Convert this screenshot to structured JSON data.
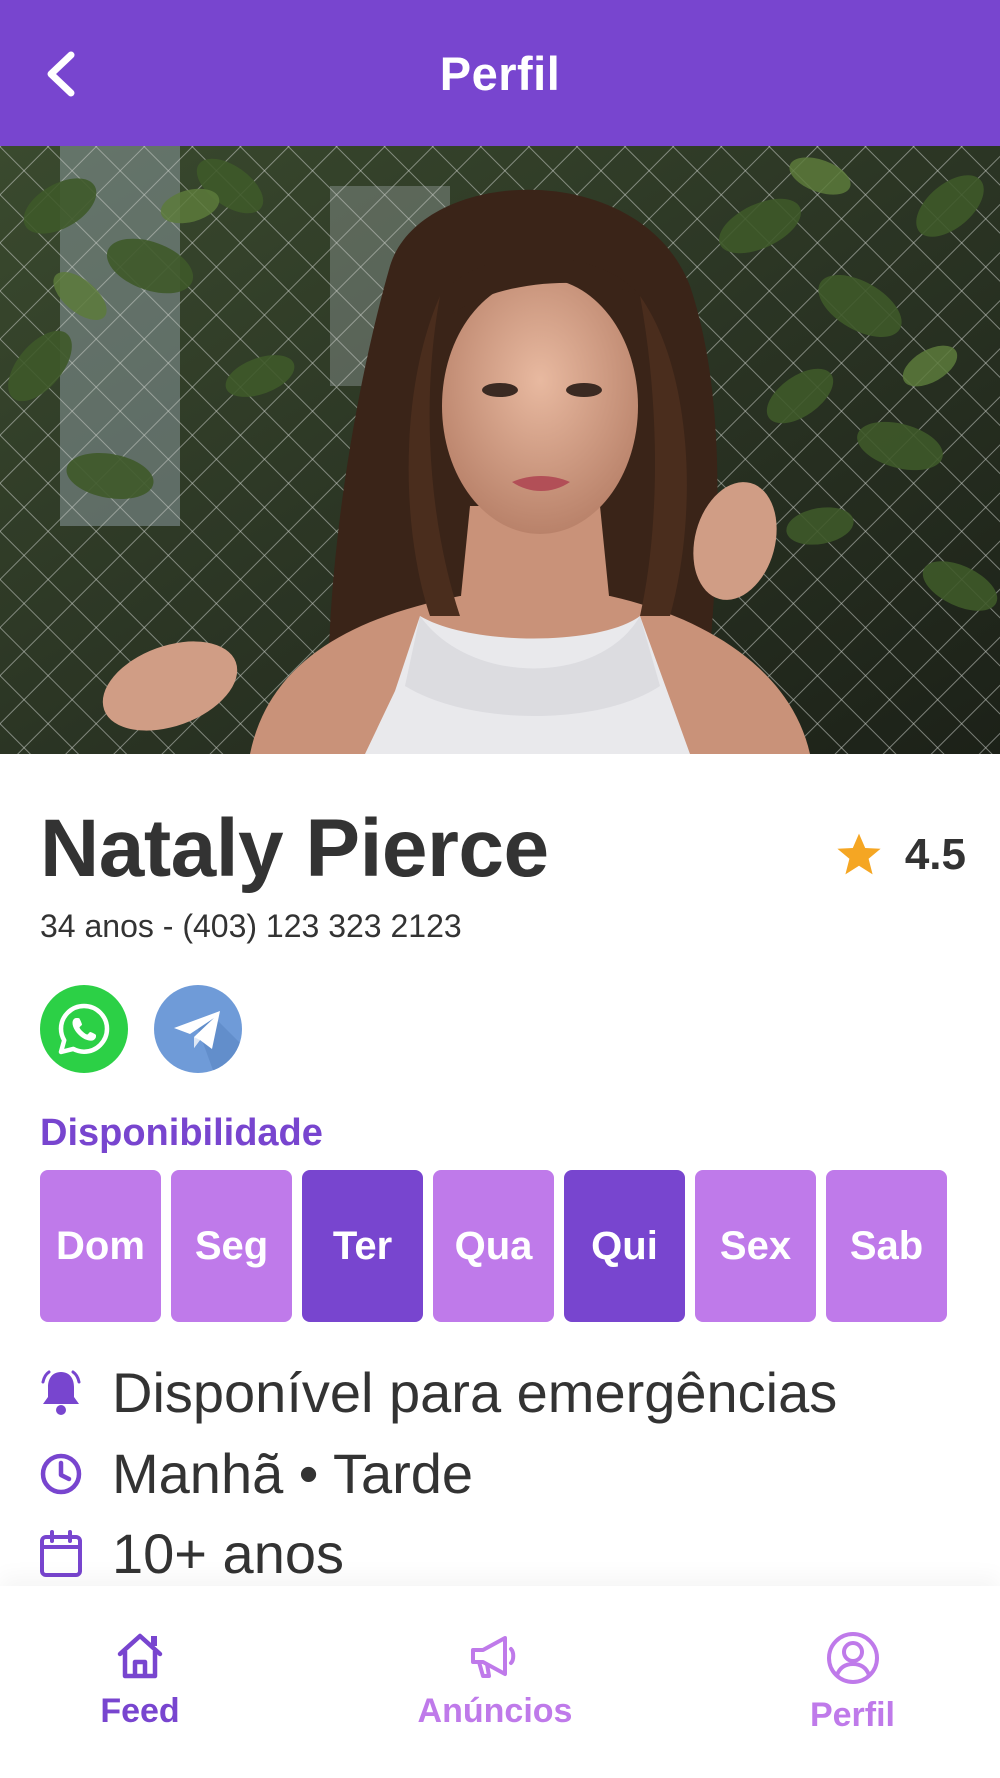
{
  "header": {
    "title": "Perfil",
    "back_icon": "chevron-left-icon"
  },
  "photo": {
    "description_icon": "profile-photo"
  },
  "profile": {
    "name": "Nataly Pierce",
    "rating": "4.5",
    "subinfo": "34 anos - (403) 123 323 2123"
  },
  "social": [
    {
      "name": "whatsapp-icon",
      "color": "#2CD046"
    },
    {
      "name": "telegram-icon",
      "color": "#6F9BD8"
    }
  ],
  "availability": {
    "title": "Disponibilidade",
    "days": [
      {
        "label": "Dom",
        "active": false
      },
      {
        "label": "Seg",
        "active": false
      },
      {
        "label": "Ter",
        "active": true
      },
      {
        "label": "Qua",
        "active": false
      },
      {
        "label": "Qui",
        "active": true
      },
      {
        "label": "Sex",
        "active": false
      },
      {
        "label": "Sab",
        "active": false
      }
    ]
  },
  "details": {
    "emergency": "Disponível para emergências",
    "shifts": "Manhã • Tarde",
    "experience": "10+ anos"
  },
  "nav": {
    "feed": "Feed",
    "ads": "Anúncios",
    "profile": "Perfil"
  },
  "colors": {
    "primary": "#7845CF",
    "light": "#BF7AEA",
    "star": "#F5A623",
    "text": "#333333"
  }
}
